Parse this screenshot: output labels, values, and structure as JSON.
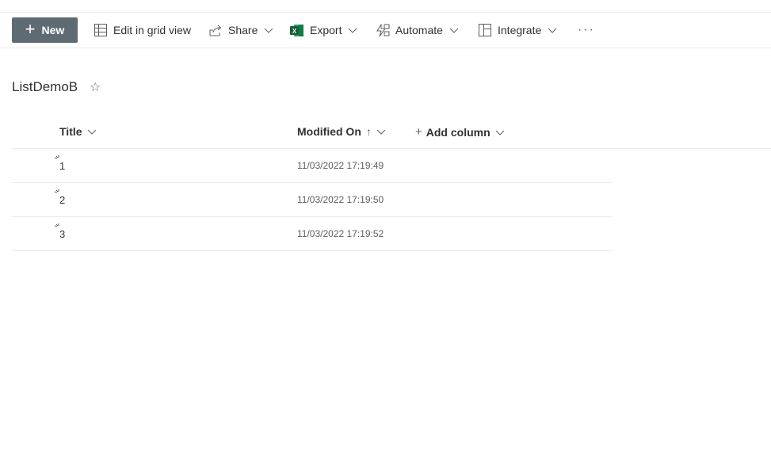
{
  "toolbar": {
    "new_label": "New",
    "edit_grid_label": "Edit in grid view",
    "share_label": "Share",
    "export_label": "Export",
    "automate_label": "Automate",
    "integrate_label": "Integrate",
    "more_label": "···"
  },
  "list": {
    "title": "ListDemoB",
    "columns": {
      "title": "Title",
      "modified": "Modified On",
      "modified_sort": "↑",
      "add_column": "Add column"
    },
    "rows": [
      {
        "title": "1",
        "modified": "11/03/2022 17:19:49"
      },
      {
        "title": "2",
        "modified": "11/03/2022 17:19:50"
      },
      {
        "title": "3",
        "modified": "11/03/2022 17:19:52"
      }
    ]
  },
  "colors": {
    "new_button_bg": "#5f6b73",
    "excel_green": "#107c41",
    "divider": "#edebe9"
  }
}
